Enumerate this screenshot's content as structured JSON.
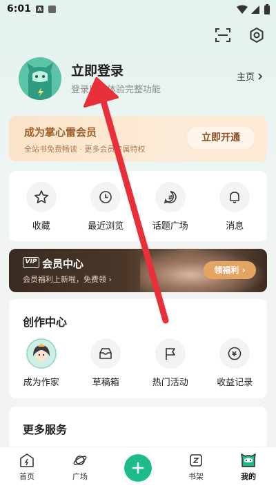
{
  "status": {
    "time": "6:01",
    "badge1": "A"
  },
  "profile": {
    "title": "立即登录",
    "subtitle": "登录后，体验完整功能",
    "home_link": "主页"
  },
  "vip": {
    "title": "成为掌心雷会员",
    "subtitle": "全站书免费畅读 · 更多会员专属特权",
    "button": "立即开通"
  },
  "quick_actions": [
    {
      "label": "收藏",
      "icon": "star-icon"
    },
    {
      "label": "最近浏览",
      "icon": "clock-icon"
    },
    {
      "label": "话题广场",
      "icon": "hashtag-icon"
    },
    {
      "label": "消息",
      "icon": "bell-icon"
    }
  ],
  "member": {
    "badge": "VIP",
    "title": "会员中心",
    "subtitle": "会员福利上新啦，免费领",
    "button": "领福利"
  },
  "create": {
    "title": "创作中心",
    "items": [
      {
        "label": "成为作家",
        "icon": "author-avatar-icon"
      },
      {
        "label": "草稿箱",
        "icon": "drafts-icon"
      },
      {
        "label": "热门活动",
        "icon": "flag-icon"
      },
      {
        "label": "收益记录",
        "icon": "yen-icon"
      }
    ]
  },
  "more": {
    "title": "更多服务"
  },
  "nav": {
    "home": "首页",
    "plaza": "广场",
    "shelf": "书架",
    "mine": "我的"
  },
  "colors": {
    "accent": "#1dbb8b",
    "annotation": "#e8303a"
  }
}
